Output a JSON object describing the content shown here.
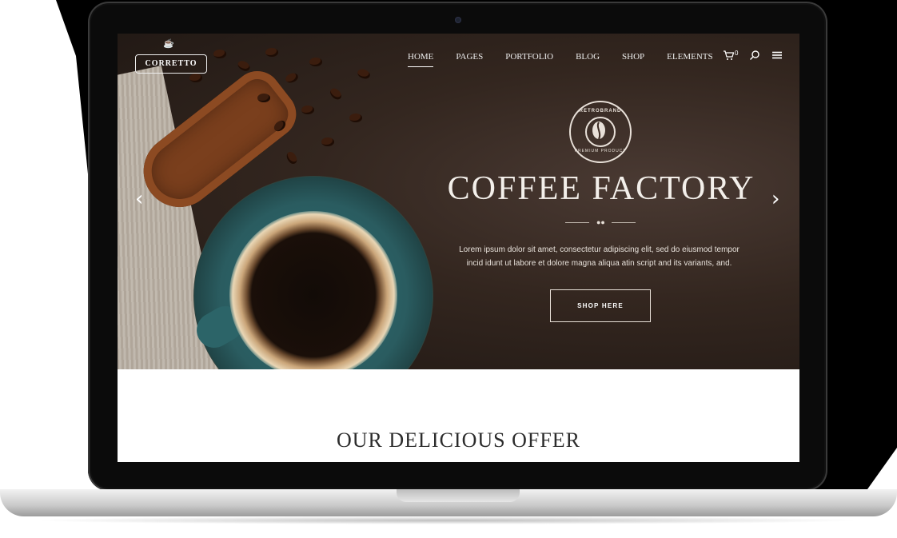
{
  "logo": {
    "text": "CORRETTO"
  },
  "nav": {
    "items": [
      "HOME",
      "PAGES",
      "PORTFOLIO",
      "BLOG",
      "SHOP",
      "ELEMENTS"
    ],
    "active": "HOME",
    "cart_count": "0"
  },
  "badge": {
    "top_text": "RETROBRAND",
    "bottom_text": "PREMIUM PRODUCT"
  },
  "hero": {
    "title": "COFFEE FACTORY",
    "text_line1": "Lorem ipsum dolor sit amet, consectetur adipiscing elit, sed do eiusmod tempor",
    "text_line2": "incid idunt ut labore et dolore magna aliqua atin script and its variants, and.",
    "button_label": "SHOP HERE"
  },
  "section": {
    "heading": "OUR DELICIOUS OFFER"
  },
  "icons": {
    "cart": "cart-icon",
    "search": "search-icon",
    "menu": "hamburger-menu-icon",
    "prev": "chevron-left-icon",
    "next": "chevron-right-icon"
  }
}
